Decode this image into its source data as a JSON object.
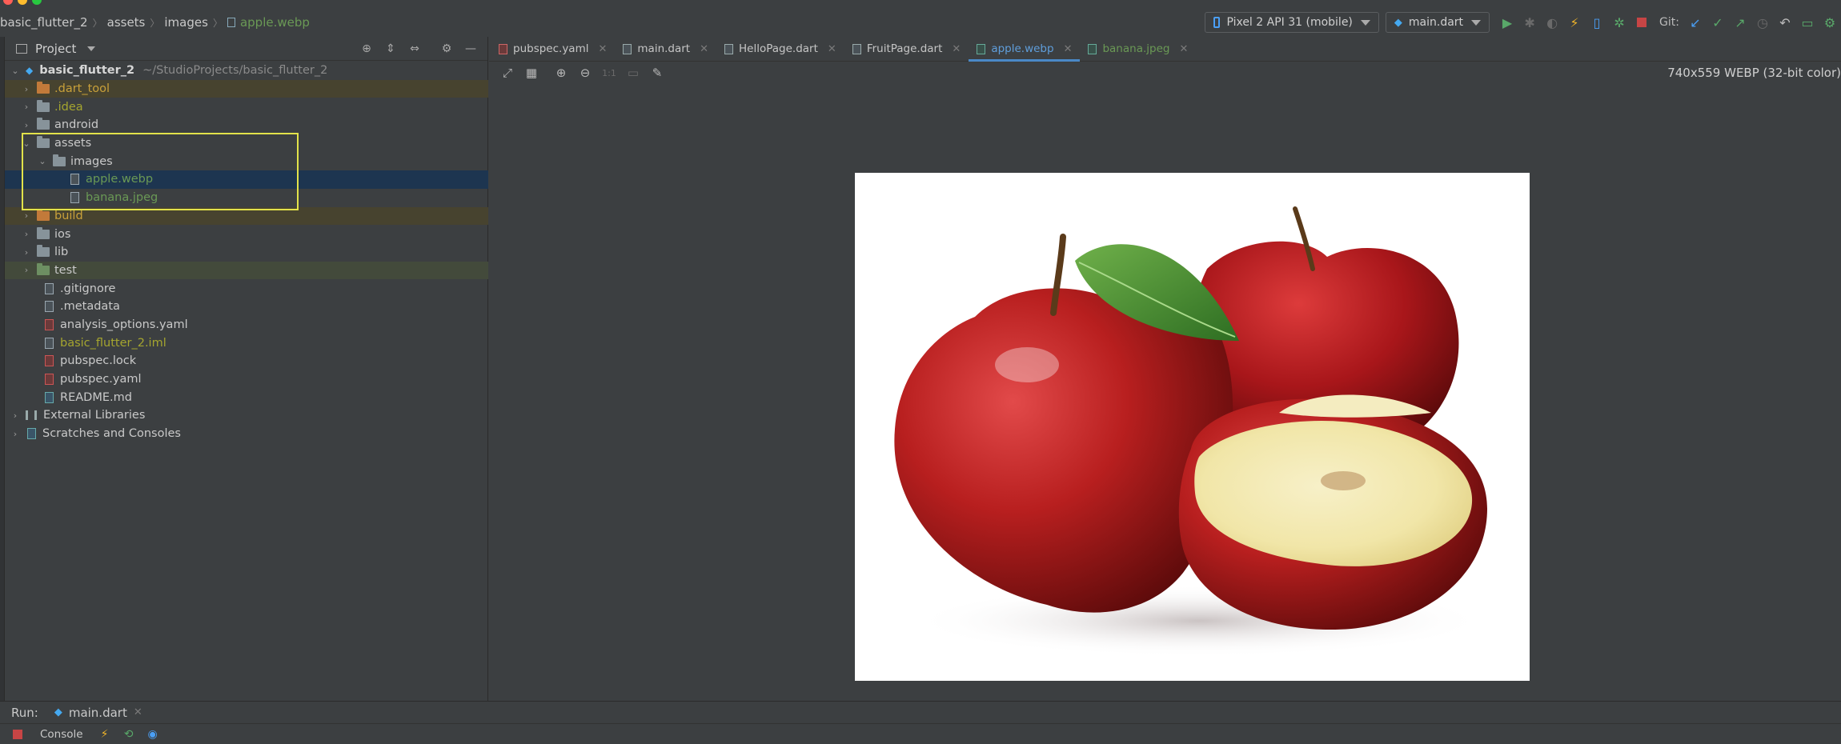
{
  "breadcrumbs": {
    "project": "basic_flutter_2",
    "folder1": "assets",
    "folder2": "images",
    "file": "apple.webp"
  },
  "toolbar": {
    "device": "Pixel 2 API 31 (mobile)",
    "run_config": "main.dart",
    "git_label": "Git:"
  },
  "project_panel": {
    "title": "Project"
  },
  "tree": {
    "root": {
      "label": "basic_flutter_2",
      "path": "~/StudioProjects/basic_flutter_2"
    },
    "dart_tool": ".dart_tool",
    "idea": ".idea",
    "android": "android",
    "assets": "assets",
    "images": "images",
    "apple": "apple.webp",
    "banana": "banana.jpeg",
    "build": "build",
    "ios": "ios",
    "lib": "lib",
    "test": "test",
    "gitignore": ".gitignore",
    "metadata": ".metadata",
    "analysis": "analysis_options.yaml",
    "iml": "basic_flutter_2.iml",
    "pubspec_lock": "pubspec.lock",
    "pubspec_yaml": "pubspec.yaml",
    "readme": "README.md",
    "external": "External Libraries",
    "scratches": "Scratches and Consoles"
  },
  "tabs": [
    {
      "label": "pubspec.yaml"
    },
    {
      "label": "main.dart"
    },
    {
      "label": "HelloPage.dart"
    },
    {
      "label": "FruitPage.dart"
    },
    {
      "label": "apple.webp"
    },
    {
      "label": "banana.jpeg"
    }
  ],
  "image_viewer": {
    "info": "740x559 WEBP (32-bit color)",
    "actual_size_label": "1:1"
  },
  "run": {
    "label": "Run:",
    "tab": "main.dart"
  },
  "console": {
    "label": "Console"
  },
  "colors": {
    "selection": "#1d3550",
    "highlight_box": "#e2e24a",
    "active_tab_underline": "#4a88c7"
  }
}
